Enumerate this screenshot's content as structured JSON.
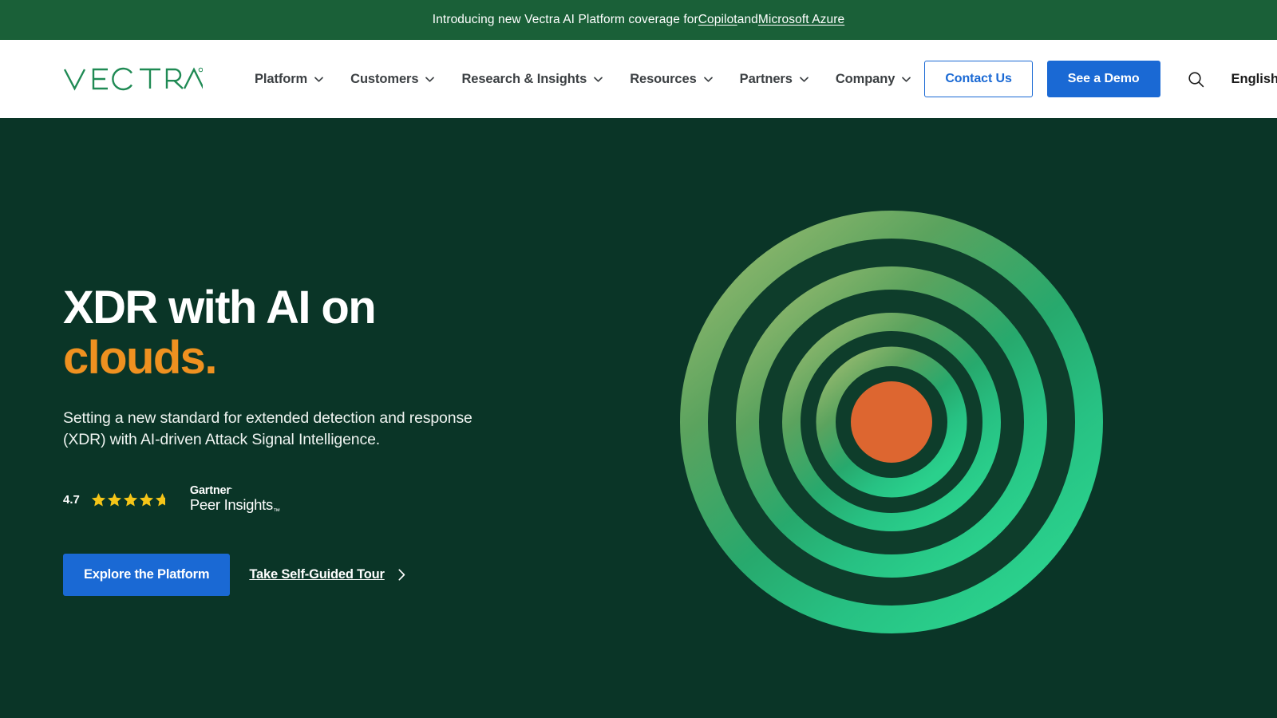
{
  "banner": {
    "text_before": "Introducing new Vectra AI Platform coverage for ",
    "link1": "Copilot",
    "text_middle": " and ",
    "link2": "Microsoft Azure"
  },
  "nav": {
    "logo_text": "VECTRA",
    "items": [
      {
        "label": "Platform",
        "icon": "chevron-down-icon"
      },
      {
        "label": "Customers",
        "icon": "chevron-down-icon"
      },
      {
        "label": "Research & Insights",
        "icon": "chevron-down-icon"
      },
      {
        "label": "Resources",
        "icon": "chevron-down-icon"
      },
      {
        "label": "Partners",
        "icon": "chevron-down-icon"
      },
      {
        "label": "Company",
        "icon": "chevron-down-icon"
      }
    ],
    "contact_label": "Contact Us",
    "demo_label": "See a Demo",
    "search_icon": "search-icon",
    "language": "English"
  },
  "hero": {
    "headline_line1": "XDR with AI on",
    "headline_line2": "clouds.",
    "subhead": "Setting a new standard for extended detection and response (XDR) with AI-driven Attack Signal Intelligence.",
    "rating": {
      "score": "4.7",
      "stars_total": 5,
      "stars_filled": 4.7,
      "brand_top": "Gartner",
      "brand_top_mark": ".",
      "brand_bottom": "Peer Insights",
      "brand_bottom_mark": "™"
    },
    "cta_primary": "Explore the Platform",
    "cta_secondary": "Take Self-Guided Tour",
    "cta_secondary_icon": "chevron-right-icon"
  },
  "colors": {
    "banner_green": "#1a6038",
    "hero_bg": "#0a3527",
    "brand_green": "#1f8a54",
    "accent_orange": "#ef9120",
    "center_orange": "#dd6630",
    "button_blue": "#1a69d4",
    "ring_light": "#8cb46a",
    "ring_bright": "#28c585",
    "ring_dark": "#0e3d2b",
    "star_gold": "#f5c518"
  }
}
